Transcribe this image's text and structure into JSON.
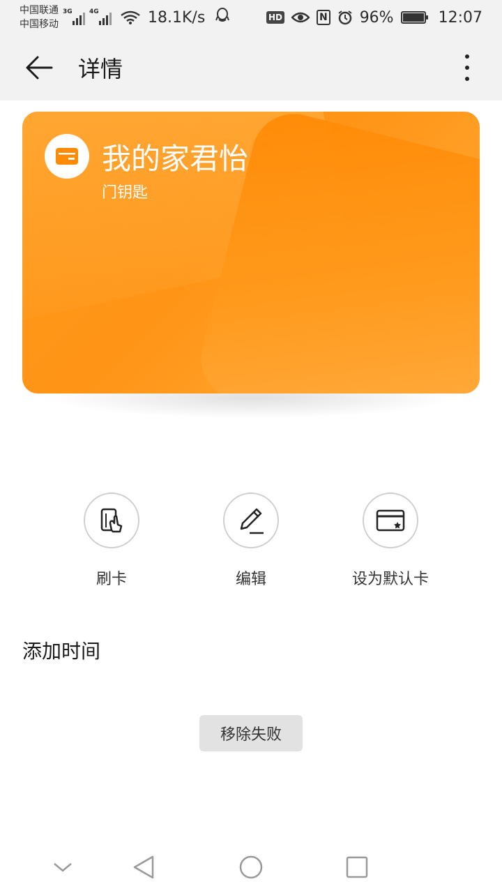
{
  "status_bar": {
    "carrier_1": "中国联通",
    "carrier_2": "中国移动",
    "network_1": "3G",
    "network_2": "4G",
    "speed": "18.1K/s",
    "hd_badge": "HD",
    "nfc_badge": "N",
    "battery": "96%",
    "time": "12:07"
  },
  "app_bar": {
    "title": "详情"
  },
  "card": {
    "name": "我的家君怡",
    "type": "门钥匙",
    "accent": "#ff9416"
  },
  "actions": [
    {
      "label": "刷卡",
      "icon": "swipe-card-icon"
    },
    {
      "label": "编辑",
      "icon": "pencil-icon"
    },
    {
      "label": "设为默认卡",
      "icon": "default-card-icon"
    }
  ],
  "section": {
    "added_time_label": "添加时间"
  },
  "toast": {
    "message": "移除失败"
  },
  "nav": {
    "icons": [
      "chevron-down-icon",
      "back-triangle-icon",
      "home-circle-icon",
      "recent-square-icon"
    ]
  }
}
